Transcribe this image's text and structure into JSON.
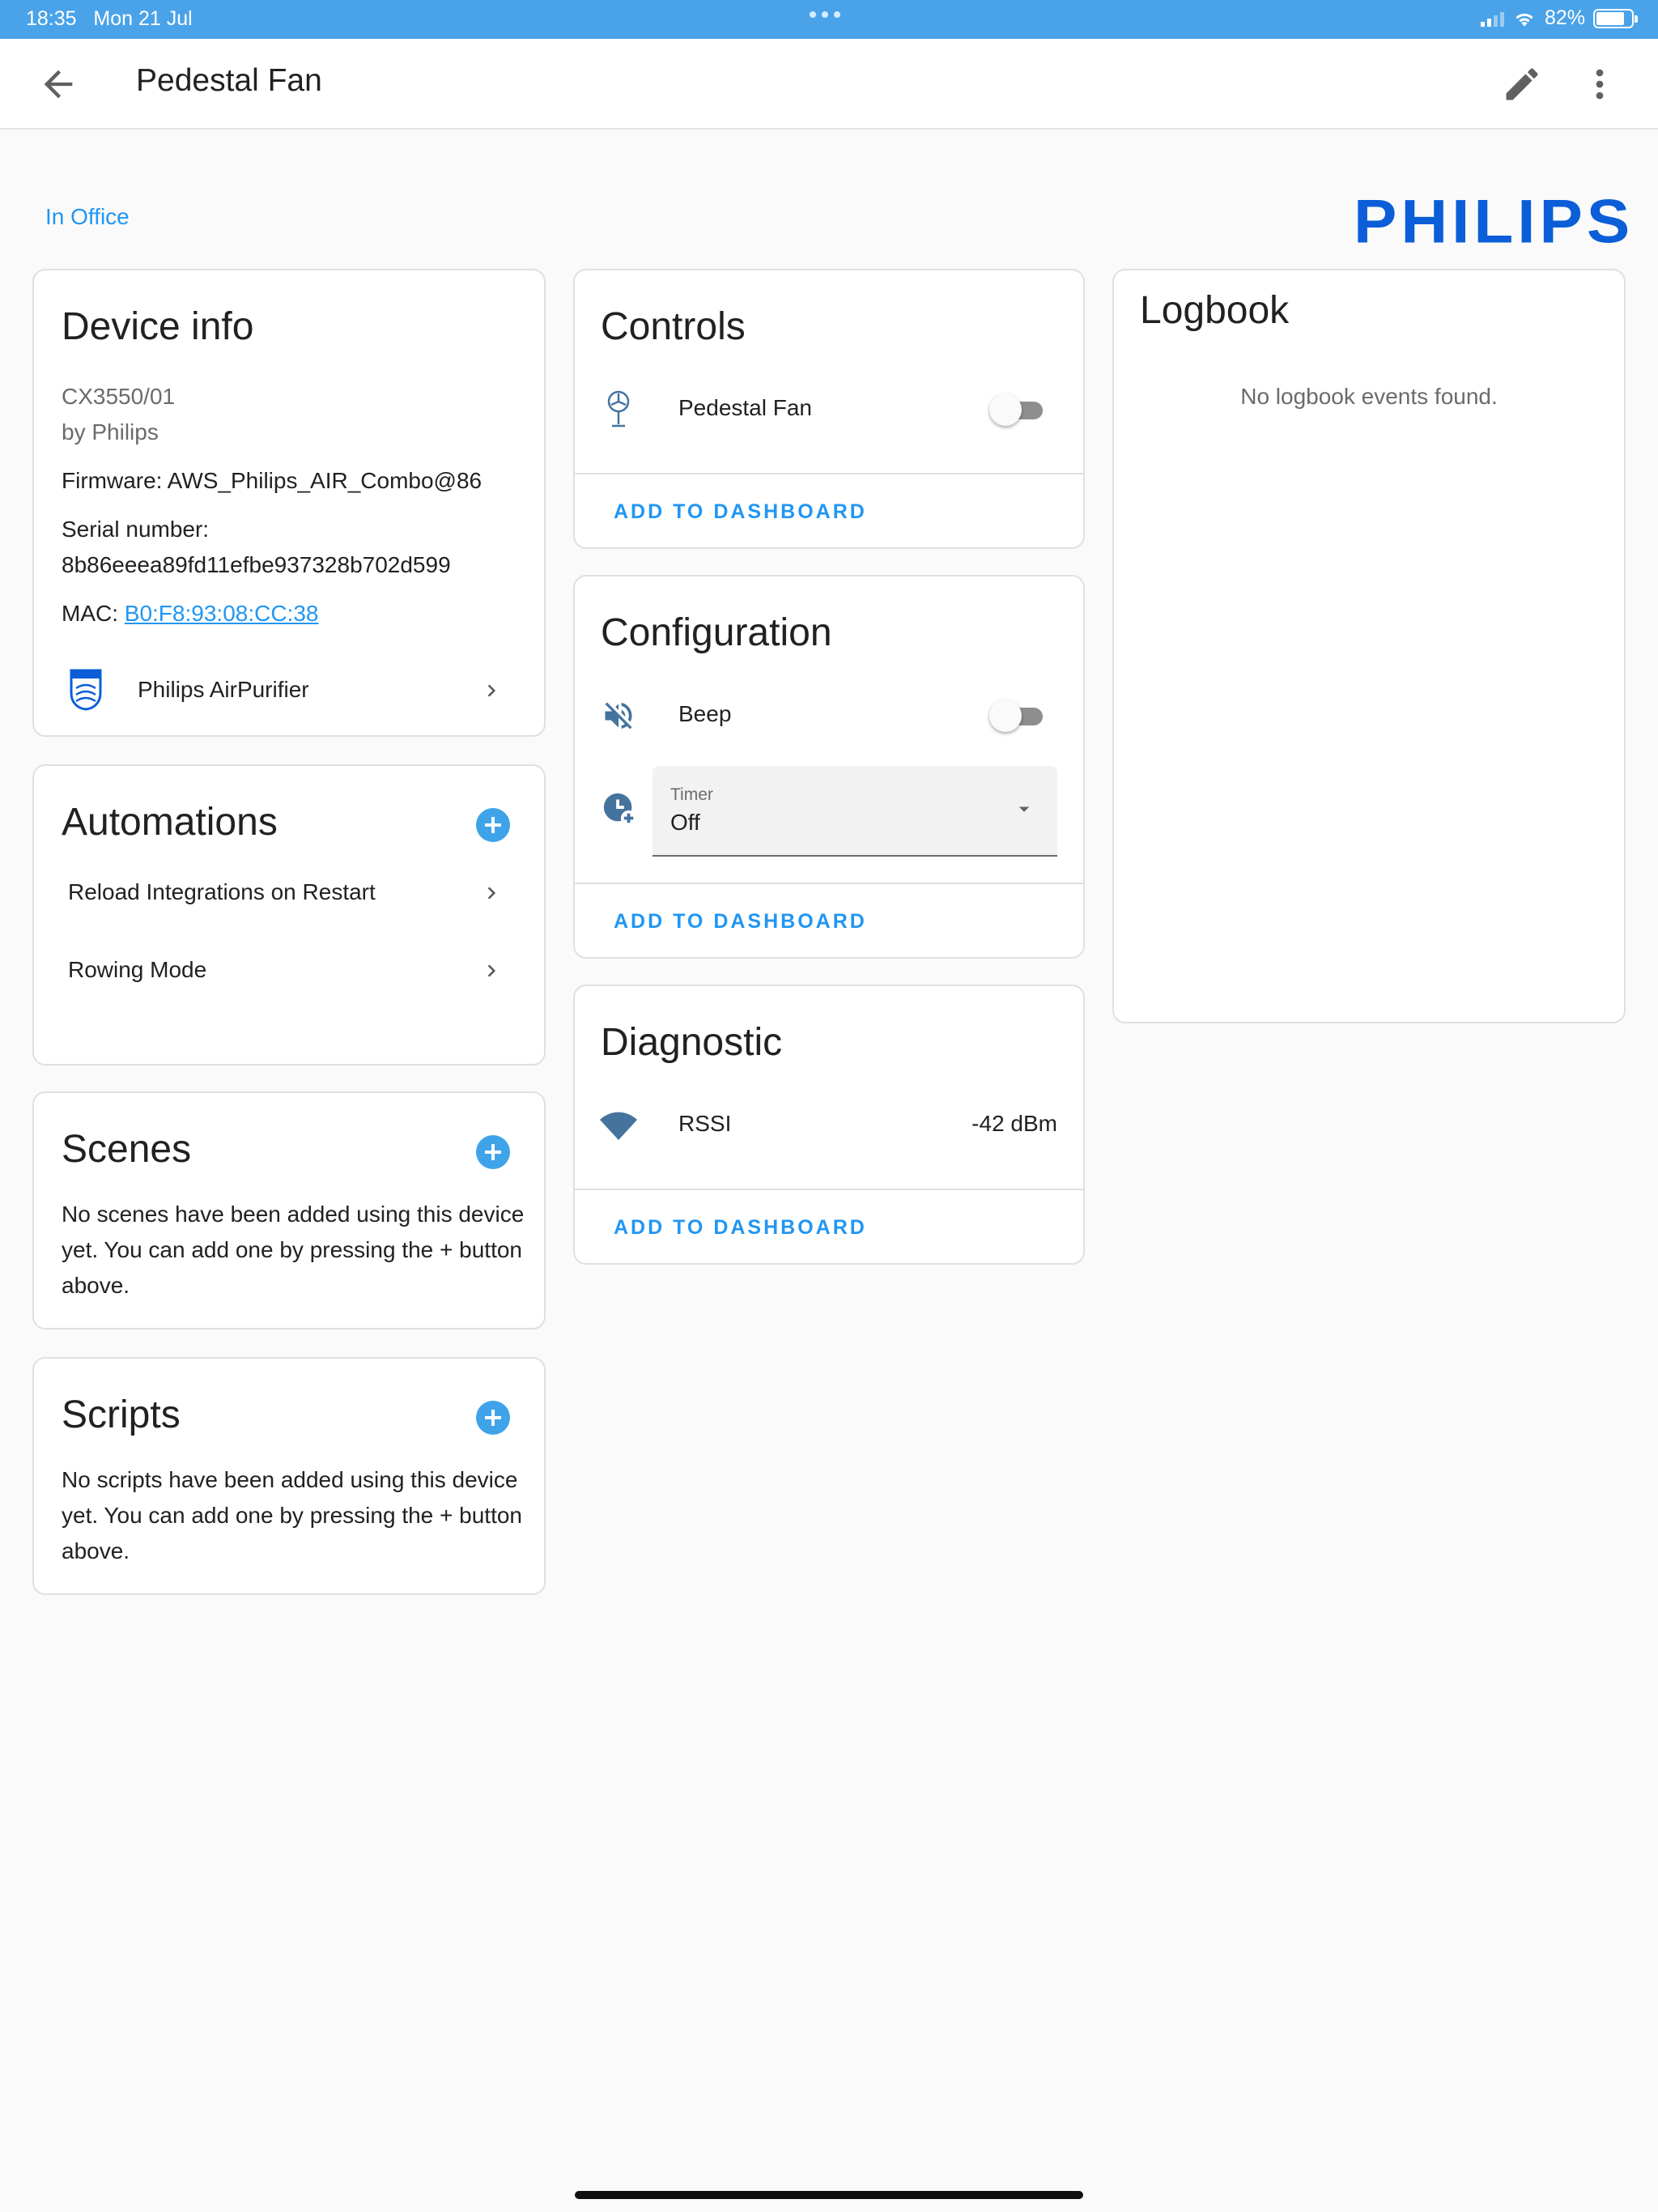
{
  "status_bar": {
    "time": "18:35",
    "date": "Mon 21 Jul",
    "battery": "82%"
  },
  "header": {
    "title": "Pedestal Fan",
    "icons": [
      "arrow-left-icon",
      "pencil-icon",
      "dots-vertical-icon"
    ]
  },
  "area": "In Office",
  "brand_logo": "PHILIPS",
  "device_info": {
    "title": "Device info",
    "model": "CX3550/01",
    "manufacturer": "by Philips",
    "firmware": "Firmware: AWS_Philips_AIR_Combo@86",
    "serial_label": "Serial number:",
    "serial_value": "8b86eeea89fd11efbe937328b702d599",
    "mac_label": "MAC:",
    "mac_value": "B0:F8:93:08:CC:38",
    "integration": "Philips AirPurifier"
  },
  "automations": {
    "title": "Automations",
    "items": [
      {
        "label": "Reload Integrations on Restart"
      },
      {
        "label": "Rowing Mode"
      }
    ]
  },
  "scenes": {
    "title": "Scenes",
    "empty_text": "No scenes have been added using this device yet. You can add one by pressing the + button above."
  },
  "scripts": {
    "title": "Scripts",
    "empty_text": "No scripts have been added using this device yet. You can add one by pressing the + button above."
  },
  "controls": {
    "title": "Controls",
    "entity": "Pedestal Fan",
    "entity_state": "off",
    "action": "ADD TO DASHBOARD"
  },
  "configuration": {
    "title": "Configuration",
    "beep_label": "Beep",
    "beep_state": "off",
    "timer_label": "Timer",
    "timer_value": "Off",
    "action": "ADD TO DASHBOARD"
  },
  "diagnostic": {
    "title": "Diagnostic",
    "rssi_label": "RSSI",
    "rssi_value": "-42 dBm",
    "action": "ADD TO DASHBOARD"
  },
  "logbook": {
    "title": "Logbook",
    "empty_text": "No logbook events found."
  },
  "colors": {
    "accent": "#2196f3",
    "status_bar": "#4aa3e8",
    "brand": "#0b5ed7",
    "icon": "#44739e"
  }
}
